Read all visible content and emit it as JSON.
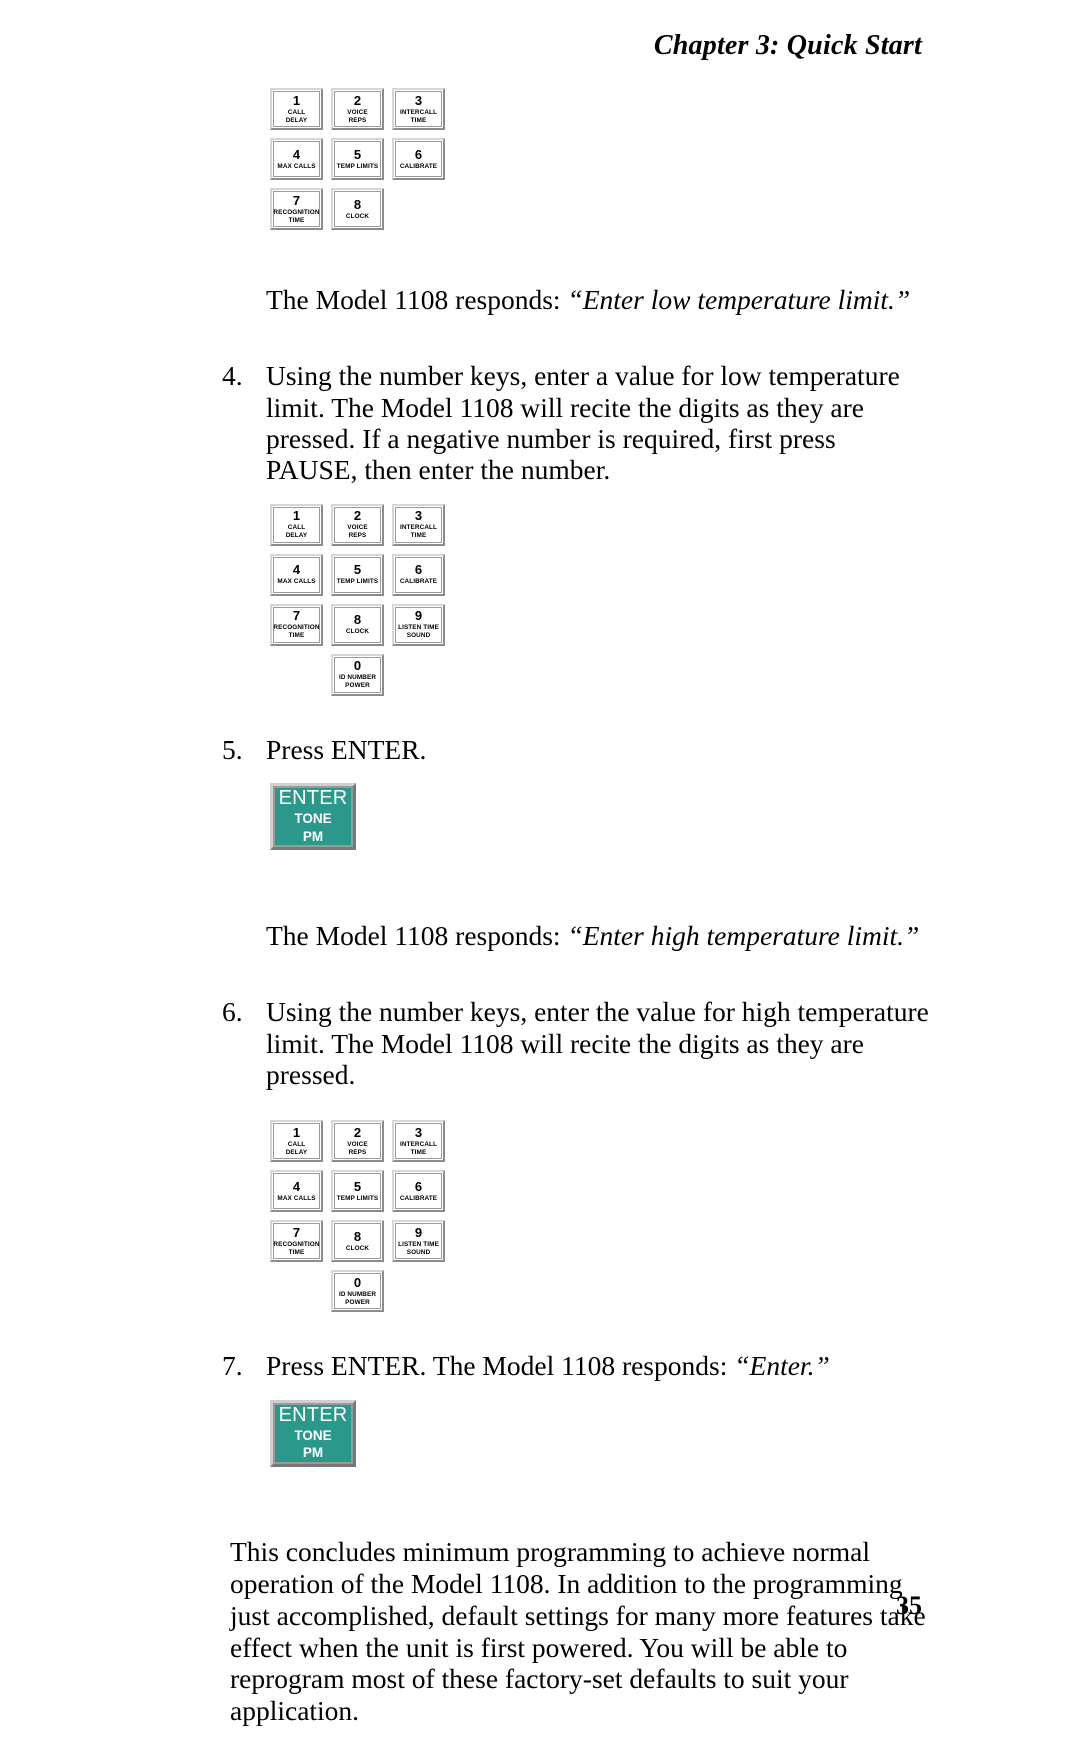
{
  "header": {
    "running_head": "Chapter 3: Quick Start"
  },
  "footer": {
    "page_number": "35"
  },
  "keys": {
    "k1": {
      "digit": "1",
      "label": "CALL\nDELAY"
    },
    "k2": {
      "digit": "2",
      "label": "VOICE\nREPS"
    },
    "k3": {
      "digit": "3",
      "label": "INTERCALL\nTIME"
    },
    "k4": {
      "digit": "4",
      "label": "MAX CALLS"
    },
    "k5": {
      "digit": "5",
      "label": "TEMP LIMITS"
    },
    "k6": {
      "digit": "6",
      "label": "CALIBRATE"
    },
    "k7": {
      "digit": "7",
      "label": "RECOGNITION\nTIME"
    },
    "k8": {
      "digit": "8",
      "label": "CLOCK"
    },
    "k9": {
      "digit": "9",
      "label": "LISTEN TIME\nSOUND"
    },
    "k0": {
      "digit": "0",
      "label": "ID NUMBER\nPOWER"
    },
    "enter": {
      "main": "ENTER",
      "sub1": "TONE",
      "sub2": "PM",
      "color": "#2a998c"
    }
  },
  "body": {
    "response_low": {
      "lead": "The Model 1108 responds: ",
      "quote": "“Enter low temperature limit.”"
    },
    "step4": {
      "number": "4.",
      "text": "Using the number keys, enter a value for low temperature limit. The Model 1108 will recite the digits as they are pressed. If a negative number is required, first press PAUSE, then enter the number."
    },
    "step5": {
      "number": "5.",
      "text": "Press ENTER."
    },
    "response_high": {
      "lead": "The Model 1108 responds: ",
      "quote": "“Enter high temperature limit.”"
    },
    "step6": {
      "number": "6.",
      "text": "Using the number keys, enter the value for high temperature limit. The Model 1108 will recite the digits as they are pressed."
    },
    "step7": {
      "number": "7.",
      "lead": "Press ENTER. The Model 1108 responds: ",
      "quote": "“Enter.”"
    },
    "closing": {
      "text": "This concludes minimum programming to achieve normal operation of the Model 1108. In addition to the programming just accomplished, default settings for many more features take effect when the unit is first powered. You will be able to reprogram most of these factory-set defaults to suit your application."
    }
  }
}
